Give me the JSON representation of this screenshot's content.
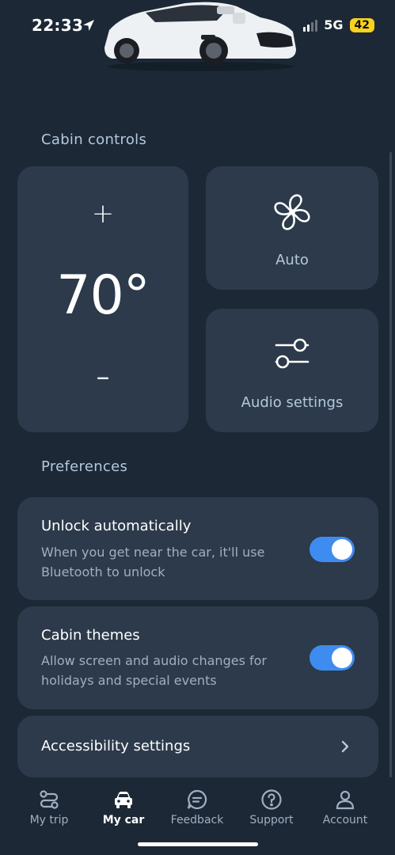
{
  "status_bar": {
    "time": "22:33",
    "network": "5G",
    "battery": "42"
  },
  "cabin_controls": {
    "title": "Cabin controls",
    "temperature": {
      "increase_symbol": "+",
      "value": "70°",
      "decrease_symbol": "–"
    },
    "fan": {
      "label": "Auto",
      "icon": "fan-icon"
    },
    "audio": {
      "label": "Audio settings",
      "icon": "sliders-icon"
    }
  },
  "preferences": {
    "title": "Preferences",
    "items": [
      {
        "title": "Unlock automatically",
        "description": "When you get near the car, it'll use Bluetooth to unlock",
        "enabled": true
      },
      {
        "title": "Cabin themes",
        "description": "Allow screen and audio changes for holidays and special events",
        "enabled": true
      }
    ],
    "accessibility": {
      "label": "Accessibility settings"
    }
  },
  "tabs": [
    {
      "label": "My trip",
      "icon": "route-icon",
      "active": false
    },
    {
      "label": "My car",
      "icon": "car-icon",
      "active": true
    },
    {
      "label": "Feedback",
      "icon": "chat-bubble-icon",
      "active": false
    },
    {
      "label": "Support",
      "icon": "help-circle-icon",
      "active": false
    },
    {
      "label": "Account",
      "icon": "person-icon",
      "active": false
    }
  ],
  "colors": {
    "background": "#1c2836",
    "card": "#2c3a4b",
    "accent": "#3f8cf0",
    "section_title": "#b5c8dc",
    "battery": "#f5d21e"
  }
}
